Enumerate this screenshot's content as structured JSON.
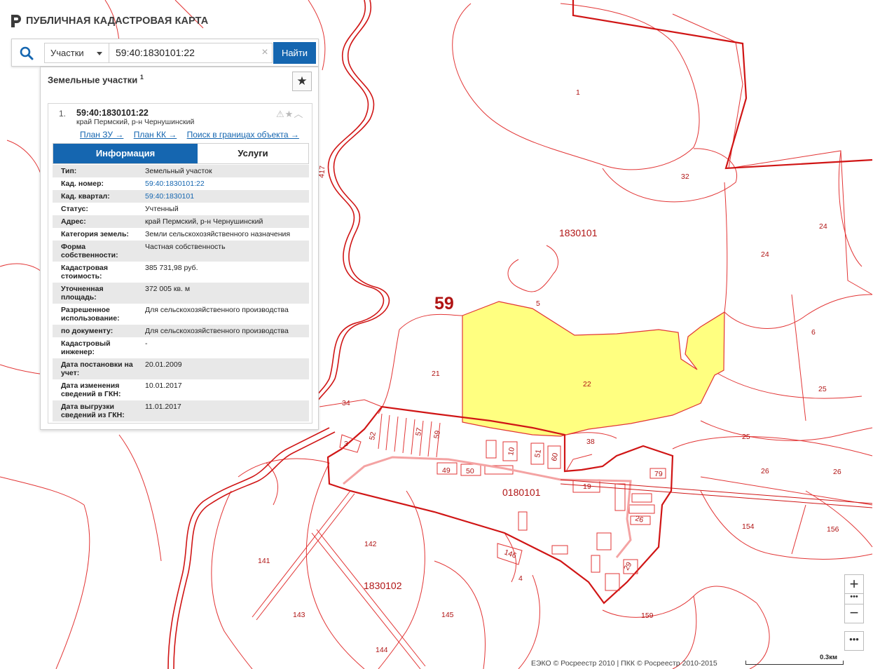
{
  "app": {
    "title": "ПУБЛИЧНАЯ КАДАСТРОВАЯ КАРТА",
    "logo_icon": "rosreestr-logo-icon"
  },
  "search": {
    "type_label": "Участки",
    "value": "59:40:1830101:22",
    "clear_symbol": "×",
    "button_label": "Найти"
  },
  "results": {
    "title": "Земельные участки",
    "count": "1",
    "item": {
      "index": "1.",
      "cad_number": "59:40:1830101:22",
      "address": "край Пермский, р-н Чернушинский",
      "links": [
        "План ЗУ →",
        "План КК →",
        "Поиск в границах объекта →"
      ],
      "tabs": {
        "info": "Информация",
        "services": "Услуги"
      },
      "attributes": [
        {
          "key": "Тип:",
          "value": "Земельный участок"
        },
        {
          "key": "Кад. номер:",
          "value": "59:40:1830101:22",
          "link": true
        },
        {
          "key": "Кад. квартал:",
          "value": "59:40:1830101",
          "link": true
        },
        {
          "key": "Статус:",
          "value": "Учтенный"
        },
        {
          "key": "Адрес:",
          "value": "край Пермский, р-н Чернушинский"
        },
        {
          "key": "Категория земель:",
          "value": "Земли сельскохозяйственного назначения"
        },
        {
          "key": "Форма собственности:",
          "value": "Частная собственность"
        },
        {
          "key": "Кадастровая стоимость:",
          "value": "385 731,98 руб."
        },
        {
          "key": "Уточненная площадь:",
          "value": "372 005 кв. м"
        },
        {
          "key": "Разрешенное использование:",
          "value": "Для сельскохозяйственного производства"
        },
        {
          "key": "по документу:",
          "value": "Для сельскохозяйственного производства"
        },
        {
          "key": "Кадастровый инженер:",
          "value": "-"
        },
        {
          "key": "Дата постановки на учет:",
          "value": "20.01.2009"
        },
        {
          "key": "Дата изменения сведений в ГКН:",
          "value": "10.01.2017"
        },
        {
          "key": "Дата выгрузки сведений из ГКН:",
          "value": "11.01.2017"
        }
      ]
    }
  },
  "map": {
    "district_label": "59",
    "quarter_labels": [
      "1830101",
      "0180101",
      "1830102"
    ],
    "parcel_labels": [
      "1",
      "32",
      "24",
      "24",
      "5",
      "6",
      "22",
      "21",
      "34",
      "25",
      "25",
      "38",
      "26",
      "26",
      "154",
      "156",
      "3",
      "52",
      "57",
      "59",
      "10",
      "51",
      "60",
      "49",
      "50",
      "79",
      "19",
      "26",
      "146",
      "4",
      "29",
      "142",
      "141",
      "143",
      "145",
      "144",
      "159",
      "417"
    ],
    "selected_parcel_color": "#ffff80",
    "boundary_color": "#d01515"
  },
  "controls": {
    "zoom_in": "+",
    "zoom_more": "•••",
    "zoom_out": "−",
    "more": "•••"
  },
  "footer": {
    "copyright": "ЕЭКО © Росреестр 2010 | ПКК © Росреестр 2010-2015",
    "scale": "0.3км"
  }
}
